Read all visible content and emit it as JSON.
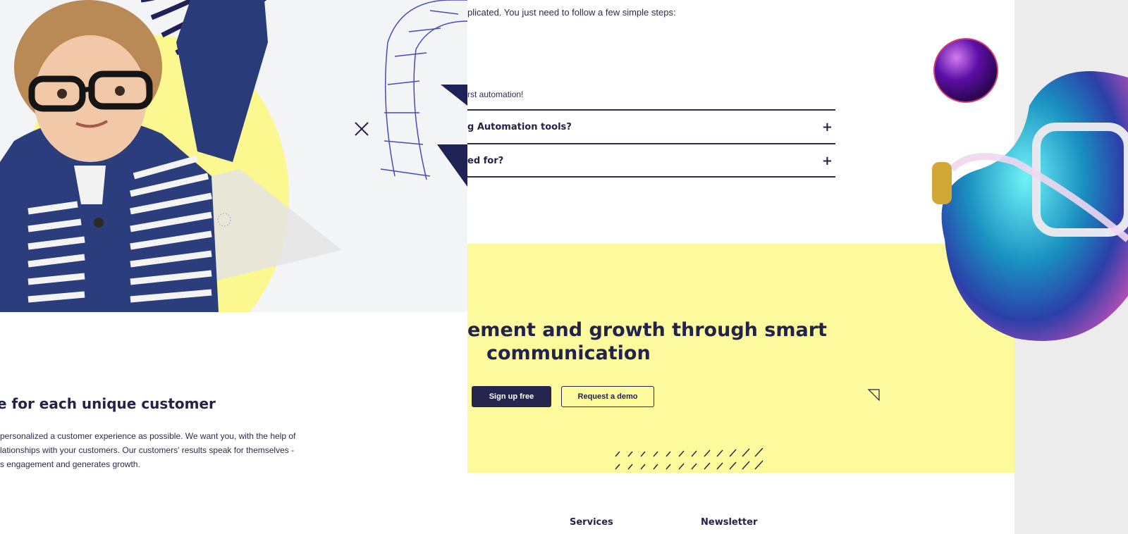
{
  "faq": {
    "intro": "plicated. You just need to follow a few simple steps:",
    "automation_text": "rst automation!",
    "items": [
      {
        "question": "g Automation tools?",
        "toggle_icon": "plus-icon"
      },
      {
        "question": "ed for?",
        "toggle_icon": "plus-icon"
      }
    ]
  },
  "about": {
    "heading": "e for each unique customer",
    "paragraph_lines": [
      "personalized a customer experience as possible. We want you, with the help of",
      "lationships with your customers. Our customers' results speak for themselves -",
      "s engagement and generates growth."
    ]
  },
  "cta": {
    "heading_line1": "ement and growth through smart",
    "heading_line2": "communication",
    "signup_label": "Sign up free",
    "demo_label": "Request a demo"
  },
  "footer": {
    "services_label": "Services",
    "newsletter_label": "Newsletter"
  },
  "colors": {
    "navy": "#22234a",
    "yellow": "#fcfa9c",
    "panel_grey": "#f3f4f6",
    "right_strip": "#ececed"
  }
}
